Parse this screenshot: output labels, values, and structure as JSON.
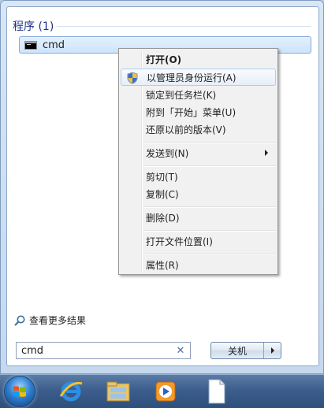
{
  "results": {
    "section_title": "程序 (1)",
    "items": [
      {
        "label": "cmd",
        "icon": "console-icon"
      }
    ]
  },
  "context_menu": {
    "items": [
      {
        "label": "打开(O)",
        "bold": true
      },
      {
        "label": "以管理员身份运行(A)",
        "icon": "uac-shield-icon",
        "highlighted": true
      },
      {
        "label": "锁定到任务栏(K)"
      },
      {
        "label": "附到「开始」菜单(U)"
      },
      {
        "label": "还原以前的版本(V)"
      },
      {
        "label": "发送到(N)",
        "submenu": true
      },
      {
        "label": "剪切(T)"
      },
      {
        "label": "复制(C)"
      },
      {
        "label": "删除(D)"
      },
      {
        "label": "打开文件位置(I)"
      },
      {
        "label": "属性(R)"
      }
    ]
  },
  "more_results": {
    "label": "查看更多结果"
  },
  "search": {
    "value": "cmd"
  },
  "shutdown": {
    "label": "关机"
  },
  "taskbar": {
    "items": [
      "start-orb",
      "internet-explorer-icon",
      "windows-explorer-icon",
      "media-player-icon",
      "document-icon"
    ]
  },
  "colors": {
    "accent": "#1e3287",
    "highlight_border": "#84acdd",
    "taskbar": "#3d5e8c"
  }
}
